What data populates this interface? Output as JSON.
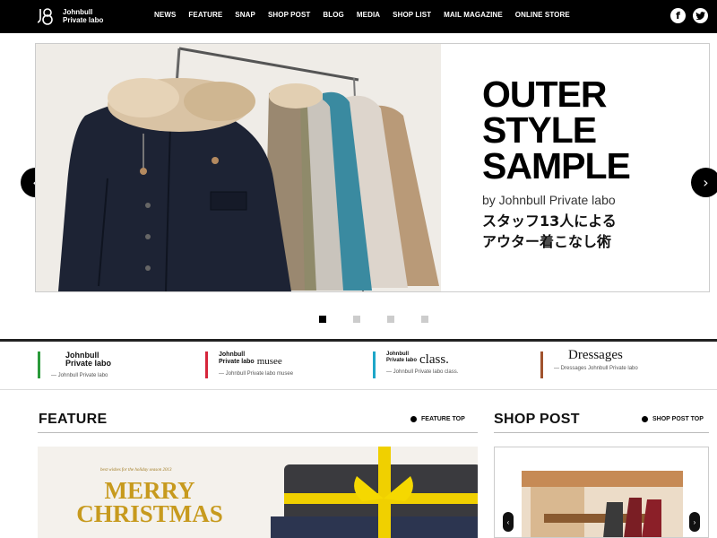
{
  "header": {
    "logo_line1": "Johnbull",
    "logo_line2": "Private labo",
    "nav": [
      "NEWS",
      "FEATURE",
      "SNAP",
      "SHOP POST",
      "BLOG",
      "MEDIA",
      "SHOP LIST",
      "MAIL MAGAZINE",
      "ONLINE STORE"
    ],
    "social": {
      "facebook": "f",
      "twitter": "t"
    }
  },
  "hero": {
    "title": "OUTER\nSTYLE\nSAMPLE",
    "byline": "by Johnbull Private labo",
    "jp_text": "スタッフ13人による\nアウター着こなし術",
    "prev_arrow": "‹",
    "next_arrow": "›",
    "active_slide": 1,
    "slide_count": 4
  },
  "brands": [
    {
      "line1": "Johnbull",
      "line2": "Private labo",
      "extra": "",
      "sub": "— Johnbull Private labo",
      "color": "#2a9a3a"
    },
    {
      "line1": "Johnbull",
      "line2": "Private labo",
      "extra": "musee",
      "sub": "— Johnbull Private labo musee",
      "color": "#d6253b"
    },
    {
      "line1": "Johnbull",
      "line2": "Private labo",
      "extra": "class.",
      "sub": "— Johnbull Private labo class.",
      "color": "#1ea6c8"
    },
    {
      "line1": "",
      "line2": "",
      "extra": "Dressages",
      "sub": "— Dressages Johnbull Private labo",
      "color": "#a0522d"
    }
  ],
  "feature": {
    "title": "FEATURE",
    "link": "FEATURE TOP",
    "image_caption_small": "best wishes for the holiday season 2013",
    "image_text": "MERRY\nCHRISTMAS"
  },
  "shop_post": {
    "title": "SHOP POST",
    "link": "SHOP POST TOP",
    "prev": "‹",
    "next": "›"
  }
}
